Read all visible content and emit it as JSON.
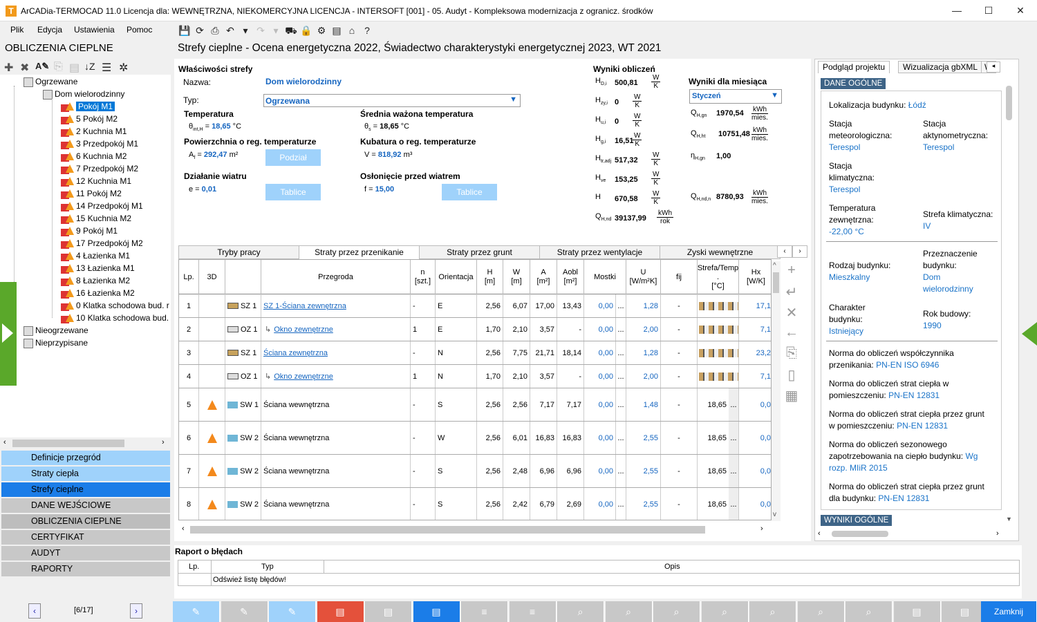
{
  "window": {
    "title": "ArCADia-TERMOCAD 11.0 Licencja dla: WEWNĘTRZNA, NIEKOMERCYJNA LICENCJA - INTERSOFT [001] - 05. Audyt - Kompleksowa modernizacja z ogranicz. środków",
    "app_icon_letter": "T"
  },
  "menu": {
    "plik": "Plik",
    "edycja": "Edycja",
    "ustawienia": "Ustawienia",
    "pomoc": "Pomoc"
  },
  "left": {
    "header": "OBLICZENIA CIEPLNE",
    "tree": {
      "root1": "Ogrzewane",
      "house": "Dom wielorodzinny",
      "rooms": [
        "Pokój M1",
        "5 Pokój M2",
        "2 Kuchnia M1",
        "3 Przedpokój M1",
        "6 Kuchnia M2",
        "7 Przedpokój M2",
        "12 Kuchnia M1",
        "11 Pokój M2",
        "14 Przedpokój M1",
        "15 Kuchnia M2",
        "9 Pokój M1",
        "17 Przedpokój M2",
        "4 Łazienka M1",
        "13 Łazienka M1",
        "8 Łazienka M2",
        "16 Łazienka M2",
        "0 Klatka schodowa bud. r",
        "10 Klatka schodowa bud."
      ],
      "root2": "Nieogrzewane",
      "root3": "Nieprzypisane"
    },
    "nav": [
      "Definicje przegród",
      "Straty ciepła",
      "Strefy cieplne",
      "DANE WEJŚCIOWE",
      "OBLICZENIA CIEPLNE",
      "CERTYFIKAT",
      "AUDYT",
      "RAPORTY"
    ],
    "pager": "[6/17]"
  },
  "page_title": "Strefy cieplne - Ocena energetyczna 2022, Świadectwo charakterystyki energetycznej 2023, WT 2021",
  "props": {
    "title": "Właściwości strefy",
    "name_label": "Nazwa:",
    "name_value": "Dom wielorodzinny",
    "type_label": "Typ:",
    "type_value": "Ogrzewana",
    "temp_title": "Temperatura",
    "temp_sym": "θ",
    "temp_sub": "int,H",
    "temp_value": "18,65",
    "temp_unit": "°C",
    "avgtemp_title": "Średnia ważona temperatura",
    "avgtemp_sym": "θ",
    "avgtemp_sub": "s",
    "avgtemp_value": "18,65",
    "avgtemp_unit": "°C",
    "area_title": "Powierzchnia o reg. temperaturze",
    "area_sym": "A",
    "area_sub": "f",
    "area_value": "292,47",
    "area_unit": "m²",
    "podzial": "Podział",
    "vol_title": "Kubatura o reg. temperaturze",
    "vol_sym": "V",
    "vol_value": "818,92",
    "vol_unit": "m³",
    "wind_title": "Działanie wiatru",
    "wind_sym": "e",
    "wind_value": "0,01",
    "tablice1": "Tablice",
    "shield_title": "Osłonięcie przed wiatrem",
    "shield_sym": "f",
    "shield_value": "15,00",
    "tablice2": "Tablice"
  },
  "results": {
    "title": "Wyniki obliczeń",
    "rows": [
      {
        "sym": "H",
        "sub": "D,i",
        "val": "500,81",
        "num": "W",
        "den": "K"
      },
      {
        "sym": "H",
        "sub": "zy,i",
        "val": "0",
        "num": "W",
        "den": "K"
      },
      {
        "sym": "H",
        "sub": "u,i",
        "val": "0",
        "num": "W",
        "den": "K"
      },
      {
        "sym": "H",
        "sub": "g,i",
        "val": "16,51",
        "num": "W",
        "den": "K"
      },
      {
        "sym": "H",
        "sub": "tr,adj",
        "val": "517,32",
        "num": "W",
        "den": "K"
      },
      {
        "sym": "H",
        "sub": "ve",
        "val": "153,25",
        "num": "W",
        "den": "K"
      },
      {
        "sym": "H",
        "sub": "",
        "val": "670,58",
        "num": "W",
        "den": "K"
      },
      {
        "sym": "Q",
        "sub": "H,nd",
        "val": "39137,99",
        "num": "kWh",
        "den": "rok"
      }
    ]
  },
  "month": {
    "title": "Wyniki dla miesiąca",
    "select": "Styczeń",
    "rows": [
      {
        "sym": "Q",
        "sub": "H,gn",
        "val": "1970,54",
        "num": "kWh",
        "den": "mies."
      },
      {
        "sym": "Q",
        "sub": "H,ht",
        "val": "10751,48",
        "num": "kWh",
        "den": "mies."
      },
      {
        "sym": "η",
        "sub": "H,gn",
        "val": "1,00",
        "num": "",
        "den": ""
      },
      {
        "sym": "Q",
        "sub": "H,nd,n",
        "val": "8780,93",
        "num": "kWh",
        "den": "mies."
      }
    ]
  },
  "tabs": [
    "Tryby pracy",
    "Straty przez przenikanie",
    "Straty przez grunt",
    "Straty przez wentylacje",
    "Zyski wewnętrzne"
  ],
  "grid": {
    "headers": [
      "Lp.",
      "3D",
      "Przegroda",
      "n\n[szt.]",
      "Orientacja",
      "H\n[m]",
      "W\n[m]",
      "A\n[m²]",
      "Aobl\n[m²]",
      "Mostki",
      "U\n[W/m²K]",
      "fij",
      "Strefa/Temp\n.\n[°C]",
      "Hx\n[W/K]"
    ],
    "rows": [
      {
        "lp": "1",
        "kind": "wall",
        "code": "SZ 1",
        "name": "SZ 1-Ściana zewnętrzna",
        "link": true,
        "indent": false,
        "n": "-",
        "orient": "E",
        "h": "2,56",
        "w": "6,07",
        "a": "17,00",
        "aobl": "13,43",
        "mostki": "0,00",
        "u": "1,28",
        "fij": "-",
        "temp": "",
        "hx": "17,1"
      },
      {
        "lp": "2",
        "kind": "win",
        "code": "OZ 1",
        "name": "Okno zewnętrzne",
        "link": true,
        "indent": true,
        "n": "1",
        "orient": "E",
        "h": "1,70",
        "w": "2,10",
        "a": "3,57",
        "aobl": "-",
        "mostki": "0,00",
        "u": "2,00",
        "fij": "-",
        "temp": "",
        "hx": "7,1"
      },
      {
        "lp": "3",
        "kind": "wall",
        "code": "SZ 1",
        "name": "Ściana zewnętrzna",
        "link": true,
        "indent": false,
        "n": "-",
        "orient": "N",
        "h": "2,56",
        "w": "7,75",
        "a": "21,71",
        "aobl": "18,14",
        "mostki": "0,00",
        "u": "1,28",
        "fij": "-",
        "temp": "",
        "hx": "23,2"
      },
      {
        "lp": "4",
        "kind": "win",
        "code": "OZ 1",
        "name": "Okno zewnętrzne",
        "link": true,
        "indent": true,
        "n": "1",
        "orient": "N",
        "h": "1,70",
        "w": "2,10",
        "a": "3,57",
        "aobl": "-",
        "mostki": "0,00",
        "u": "2,00",
        "fij": "-",
        "temp": "",
        "hx": "7,1"
      },
      {
        "lp": "5",
        "kind": "inwall",
        "code": "SW 1",
        "name": "Ściana wewnętrzna",
        "link": false,
        "indent": false,
        "n": "-",
        "orient": "S",
        "h": "2,56",
        "w": "2,56",
        "a": "7,17",
        "aobl": "7,17",
        "mostki": "0,00",
        "u": "1,48",
        "fij": "-",
        "temp": "18,65",
        "hx": "0,0"
      },
      {
        "lp": "6",
        "kind": "inwall",
        "code": "SW 2",
        "name": "Ściana wewnętrzna",
        "link": false,
        "indent": false,
        "n": "-",
        "orient": "W",
        "h": "2,56",
        "w": "6,01",
        "a": "16,83",
        "aobl": "16,83",
        "mostki": "0,00",
        "u": "2,55",
        "fij": "-",
        "temp": "18,65",
        "hx": "0,0"
      },
      {
        "lp": "7",
        "kind": "inwall",
        "code": "SW 2",
        "name": "Ściana wewnętrzna",
        "link": false,
        "indent": false,
        "n": "-",
        "orient": "S",
        "h": "2,56",
        "w": "2,48",
        "a": "6,96",
        "aobl": "6,96",
        "mostki": "0,00",
        "u": "2,55",
        "fij": "-",
        "temp": "18,65",
        "hx": "0,0"
      },
      {
        "lp": "8",
        "kind": "inwall",
        "code": "SW 2",
        "name": "Ściana wewnętrzna",
        "link": false,
        "indent": false,
        "n": "-",
        "orient": "S",
        "h": "2,56",
        "w": "2,42",
        "a": "6,79",
        "aobl": "2,69",
        "mostki": "0,00",
        "u": "2,55",
        "fij": "-",
        "temp": "18,65",
        "hx": "0,0"
      }
    ]
  },
  "right": {
    "tabs": [
      "Podgląd projektu",
      "Wizualizacja gbXML",
      "W"
    ],
    "section1": "DANE OGÓLNE",
    "section2": "WYNIKI OGÓLNE",
    "lok_label": "Lokalizacja budynku:",
    "lok_value": "Łódź",
    "st_met_label": "Stacja meteorologiczna:",
    "st_met_value": "Terespol",
    "st_akt_label": "Stacja aktynometryczna:",
    "st_akt_value": "Terespol",
    "st_klim_label": "Stacja klimatyczna:",
    "st_klim_value": "Terespol",
    "temp_label": "Temperatura zewnętrzna:",
    "temp_value": "-22,00 °C",
    "strefa_label": "Strefa klimatyczna:",
    "strefa_value": "IV",
    "rodzaj_label": "Rodzaj budynku:",
    "rodzaj_value": "Mieszkalny",
    "przezn_label": "Przeznaczenie budynku:",
    "przezn_value": "Dom wielorodzinny",
    "char_label": "Charakter budynku:",
    "char_value": "Istniejący",
    "rok_label": "Rok budowy:",
    "rok_value": "1990",
    "norms": [
      {
        "label": "Norma do obliczeń współczynnika przenikania:",
        "value": "PN-EN ISO 6946"
      },
      {
        "label": "Norma do obliczeń strat ciepła w pomieszczeniu:",
        "value": "PN-EN 12831"
      },
      {
        "label": "Norma do obliczeń strat ciepła przez grunt w pomieszczeniu:",
        "value": "PN-EN 12831"
      },
      {
        "label": "Norma do obliczeń sezonowego zapotrzebowania na ciepło budynku:",
        "value": "Wg rozp. MIiR 2015"
      },
      {
        "label": "Norma do obliczeń strat ciepła przez grunt dla budynku:",
        "value": "PN-EN 12831"
      }
    ]
  },
  "errors": {
    "title": "Raport o błędach",
    "col_lp": "Lp.",
    "col_typ": "Typ",
    "col_opis": "Opis",
    "row_typ": "Odśwież listę błędów!"
  },
  "bottom": {
    "close": "Zamknij"
  },
  "colors": {
    "accent": "#1b7de8",
    "nav_light": "#9fd2fb",
    "close_btn": "#1b7de8",
    "red_btn": "#e4513b"
  }
}
